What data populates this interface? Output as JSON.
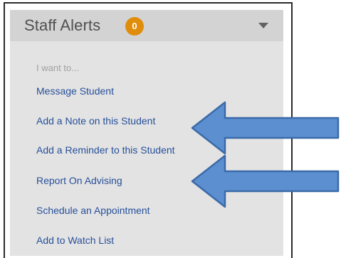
{
  "panel": {
    "title": "Staff Alerts",
    "badge_count": "0",
    "badge_color": "#e08d0c",
    "toggle_icon": "caret-down-icon"
  },
  "menu": {
    "heading": "I want to...",
    "items": [
      {
        "label": "Message Student"
      },
      {
        "label": "Add a Note on this Student"
      },
      {
        "label": "Add a Reminder to this Student"
      },
      {
        "label": "Report On Advising"
      },
      {
        "label": "Schedule an Appointment"
      },
      {
        "label": "Add to Watch List"
      }
    ]
  },
  "annotations": {
    "arrow_color": "#5b8fd0",
    "arrow_outline": "#3b6aa8",
    "arrows": [
      {
        "points_to": "Add a Note on this Student"
      },
      {
        "points_to": "Report On Advising"
      }
    ]
  }
}
